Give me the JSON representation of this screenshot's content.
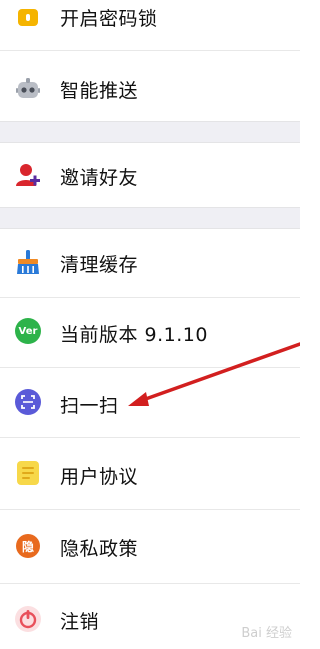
{
  "settings": {
    "items": [
      {
        "label": "开启密码锁",
        "icon": "lock-icon"
      },
      {
        "label": "智能推送",
        "icon": "robot-icon"
      },
      {
        "label": "邀请好友",
        "icon": "add-user-icon"
      },
      {
        "label": "清理缓存",
        "icon": "broom-icon"
      },
      {
        "label": "当前版本 9.1.10",
        "icon": "version-icon",
        "icon_text": "Ver"
      },
      {
        "label": "扫一扫",
        "icon": "scan-icon"
      },
      {
        "label": "用户协议",
        "icon": "document-icon"
      },
      {
        "label": "隐私政策",
        "icon": "privacy-icon",
        "icon_text": "隐"
      },
      {
        "label": "注销",
        "icon": "logout-icon"
      }
    ]
  },
  "watermark": {
    "text": "Bai 经验"
  },
  "colors": {
    "section_gap": "#efeff4",
    "arrow": "#d21f1f",
    "lock": "#f5b400",
    "version": "#2db34a",
    "scan": "#5a5ad8",
    "document": "#f7d84a",
    "privacy": "#e86a1e",
    "logout": "#e8505b"
  }
}
